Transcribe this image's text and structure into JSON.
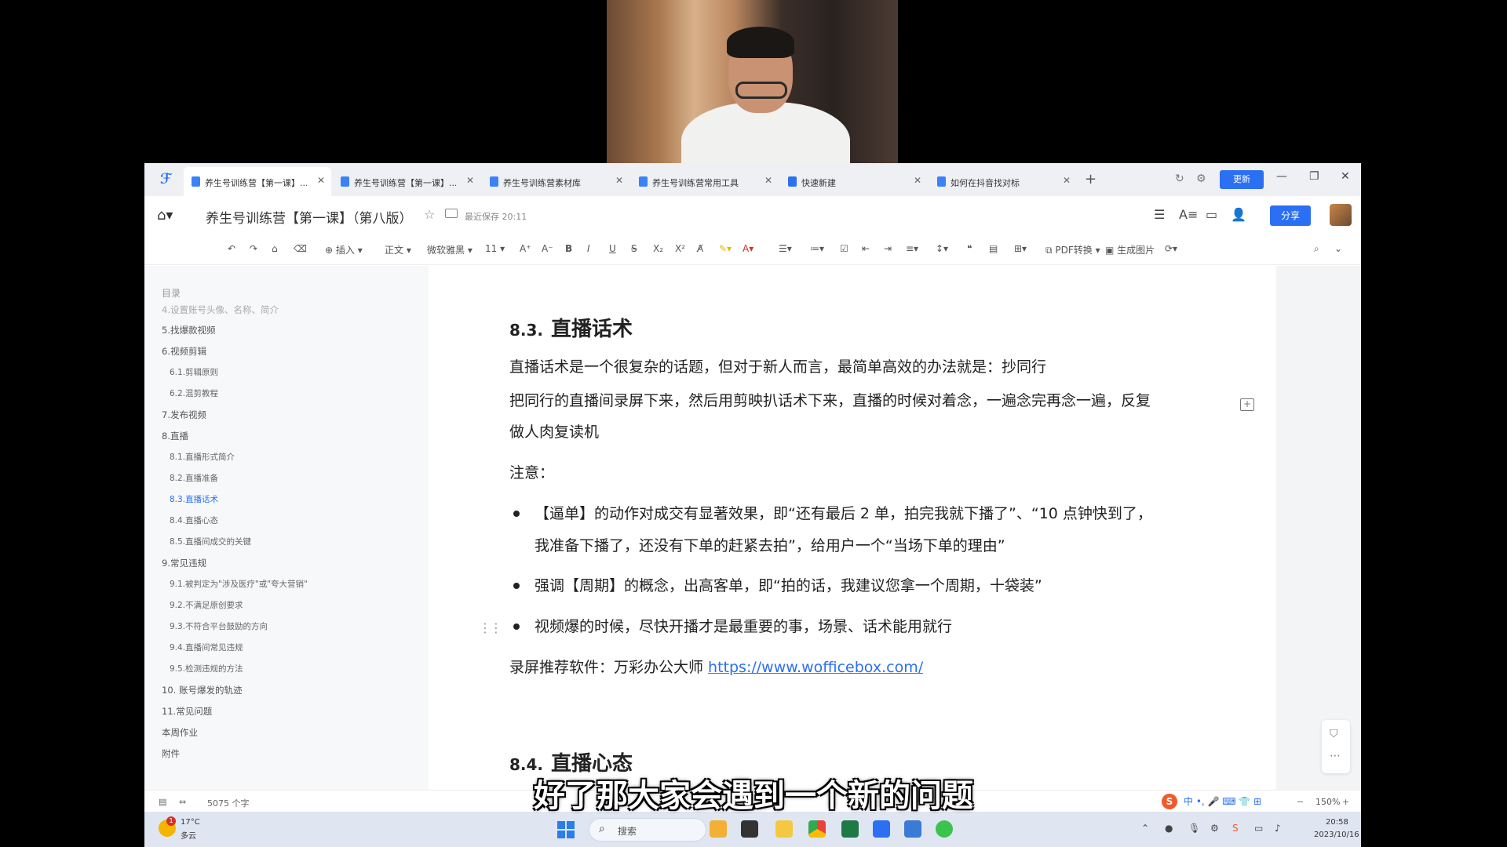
{
  "window": {
    "tabs": [
      {
        "label": "养生号训练营【第一课】..."
      },
      {
        "label": "养生号训练营【第一课】..."
      },
      {
        "label": "养生号训练营素材库"
      },
      {
        "label": "养生号训练营常用工具"
      },
      {
        "label": "快速新建"
      },
      {
        "label": "如何在抖音找对标"
      }
    ],
    "upgrade_label": "更新"
  },
  "header": {
    "doc_title": "养生号训练营【第一课】（第八版）",
    "save_status": "最近保存 20:11",
    "share_label": "分享"
  },
  "toolbar": {
    "insert": "插入",
    "style": "正文",
    "font": "微软雅黑",
    "font_size": "11",
    "pdf_convert": "PDF转换",
    "gen_image": "生成图片"
  },
  "toc": {
    "title": "目录",
    "items": [
      {
        "label": "4.设置账号头像、名称、简介",
        "level": 1
      },
      {
        "label": "5.找爆款视频",
        "level": 1
      },
      {
        "label": "6.视频剪辑",
        "level": 1
      },
      {
        "label": "6.1.剪辑原则",
        "level": 2
      },
      {
        "label": "6.2.混剪教程",
        "level": 2
      },
      {
        "label": "7.发布视频",
        "level": 1
      },
      {
        "label": "8.直播",
        "level": 1
      },
      {
        "label": "8.1.直播形式简介",
        "level": 2
      },
      {
        "label": "8.2.直播准备",
        "level": 2
      },
      {
        "label": "8.3.直播话术",
        "level": 2,
        "active": true
      },
      {
        "label": "8.4.直播心态",
        "level": 2
      },
      {
        "label": "8.5.直播间成交的关键",
        "level": 2
      },
      {
        "label": "9.常见违规",
        "level": 1
      },
      {
        "label": "9.1.被判定为\"涉及医疗\"或\"夸大营销\"",
        "level": 2
      },
      {
        "label": "9.2.不满足原创要求",
        "level": 2
      },
      {
        "label": "9.3.不符合平台鼓励的方向",
        "level": 2
      },
      {
        "label": "9.4.直播间常见违规",
        "level": 2
      },
      {
        "label": "9.5.检测违规的方法",
        "level": 2
      },
      {
        "label": "10. 账号爆发的轨迹",
        "level": 1
      },
      {
        "label": "11.常见问题",
        "level": 1
      },
      {
        "label": "本周作业",
        "level": 1
      },
      {
        "label": "附件",
        "level": 1
      }
    ]
  },
  "doc": {
    "section_8_3": {
      "num": "8.3.",
      "title": "直播话术"
    },
    "p1": "直播话术是一个很复杂的话题，但对于新人而言，最简单高效的办法就是：抄同行",
    "p2a": "把同行的直播间录屏下来，然后用剪映扒话术下来，直播的时候对着念，一遍念完再念一遍，反复",
    "p2b": "做人肉复读机",
    "note": "注意：",
    "bullets": [
      {
        "line1": "【逼单】的动作对成交有显著效果，即“还有最后 2 单，拍完我就下播了”、“10 点钟快到了，",
        "line2": "我准备下播了，还没有下单的赶紧去拍”，给用户一个“当场下单的理由”"
      },
      {
        "line1": "强调【周期】的概念，出高客单，即“拍的话，我建议您拿一个周期，十袋装”",
        "line2": ""
      },
      {
        "line1": "视频爆的时候，尽快开播才是最重要的事，场景、话术能用就行",
        "line2": ""
      }
    ],
    "record_prefix": "录屏推荐软件：万彩办公大师 ",
    "record_link": "https://www.wofficebox.com/",
    "section_8_4": {
      "num": "8.4.",
      "title": "直播心态"
    }
  },
  "statusbar": {
    "word_count": "5075 个字",
    "zoom": "150%"
  },
  "taskbar": {
    "weather_temp": "17°C",
    "weather_desc": "多云",
    "weather_badge": "1",
    "search_placeholder": "搜索",
    "time": "20:58",
    "date": "2023/10/16"
  },
  "subtitle": "好了那大家会遇到一个新的问题"
}
